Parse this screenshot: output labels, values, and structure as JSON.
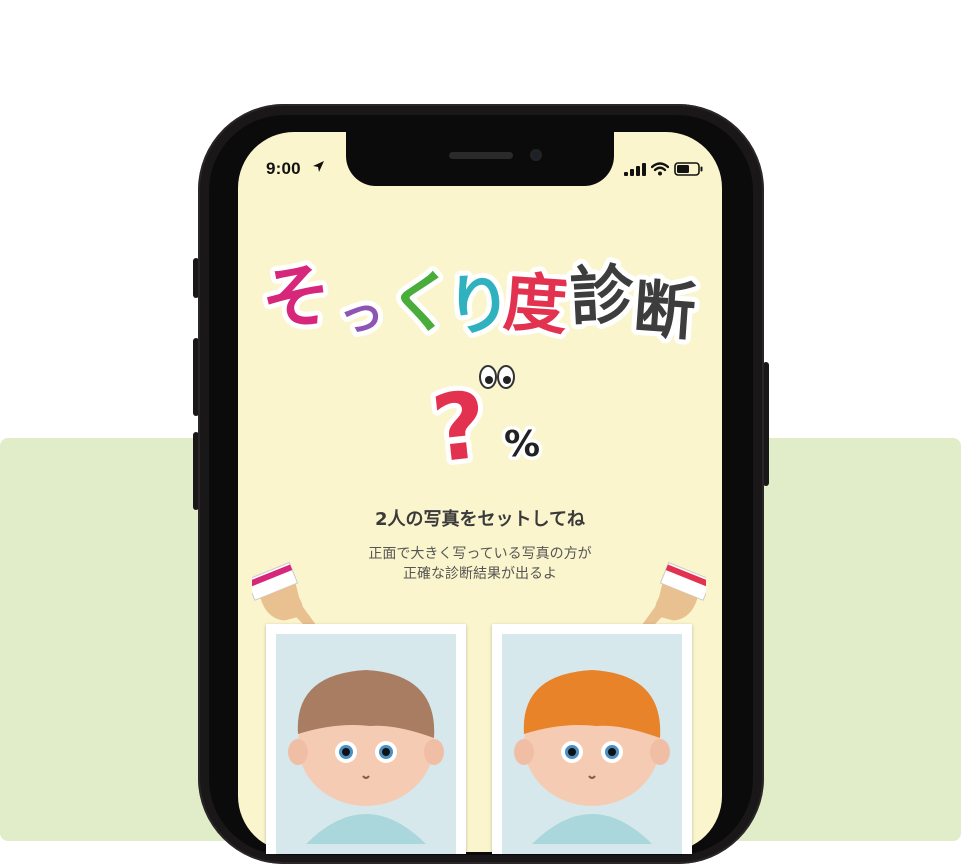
{
  "status_bar": {
    "time": "9:00",
    "location_glyph": "➤"
  },
  "logo": {
    "text": "そっくり度診断",
    "chars": [
      "そ",
      "っ",
      "く",
      "り",
      "度",
      "診",
      "断"
    ],
    "colors": [
      "#d6277b",
      "#8d55b4",
      "#4aad3b",
      "#2fb1c0",
      "#e2324f",
      "#3d3d3d",
      "#3d3d3d"
    ]
  },
  "result": {
    "value": "?",
    "unit": "%"
  },
  "heading": "2人の写真をセットしてね",
  "subtext": {
    "line1": "正面で大きく写っている写真の方が",
    "line2": "正確な診断結果が出るよ"
  },
  "colors": {
    "background_band": "#e1ecc9",
    "screen": "#fbf5cd",
    "accent_red": "#e2324f"
  }
}
